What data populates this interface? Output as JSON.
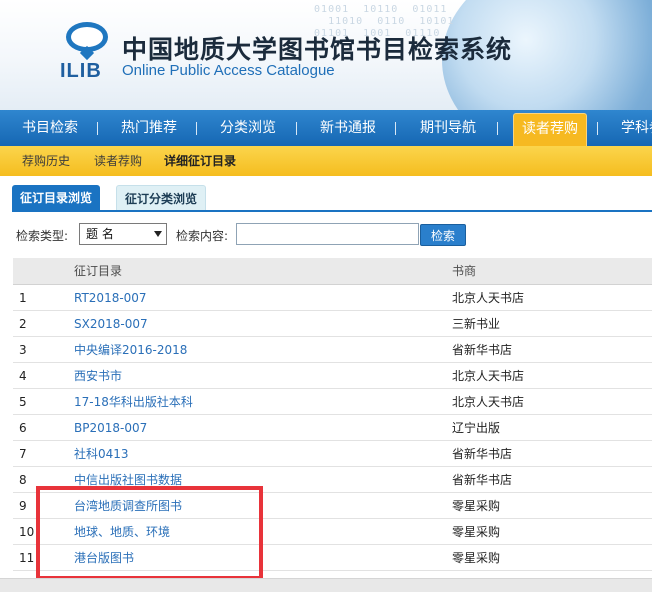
{
  "header": {
    "logo_text": "ILIB",
    "title": "中国地质大学图书馆书目检索系统",
    "subtitle": "Online Public Access Catalogue"
  },
  "nav": {
    "items": [
      "书目检索",
      "热门推荐",
      "分类浏览",
      "新书通报",
      "期刊导航",
      "读者荐购",
      "学科参"
    ],
    "active": "读者荐购"
  },
  "subnav": {
    "items": [
      "荐购历史",
      "读者荐购",
      "详细征订目录"
    ]
  },
  "tabs": {
    "items": [
      "征订目录浏览",
      "征订分类浏览"
    ]
  },
  "search": {
    "type_label": "检索类型:",
    "type_value": "题 名",
    "content_label": "检索内容:",
    "content_value": "",
    "button": "检索"
  },
  "table": {
    "headers": [
      "征订目录",
      "书商"
    ],
    "rows": [
      {
        "no": "1",
        "title": "RT2018-007",
        "vendor": "北京人天书店"
      },
      {
        "no": "2",
        "title": "SX2018-007",
        "vendor": "三新书业"
      },
      {
        "no": "3",
        "title": "中央编译2016-2018",
        "vendor": "省新华书店"
      },
      {
        "no": "4",
        "title": "西安书市",
        "vendor": "北京人天书店"
      },
      {
        "no": "5",
        "title": "17-18华科出版社本科",
        "vendor": "北京人天书店"
      },
      {
        "no": "6",
        "title": "BP2018-007",
        "vendor": "辽宁出版"
      },
      {
        "no": "7",
        "title": "社科0413",
        "vendor": "省新华书店"
      },
      {
        "no": "8",
        "title": "中信出版社图书数据",
        "vendor": "省新华书店"
      },
      {
        "no": "9",
        "title": "台湾地质调查所图书",
        "vendor": "零星采购"
      },
      {
        "no": "10",
        "title": "地球、地质、环境",
        "vendor": "零星采购"
      },
      {
        "no": "11",
        "title": "港台版图书",
        "vendor": "零星采购"
      }
    ]
  },
  "colors": {
    "nav_blue": "#1a73c2",
    "active_tab_yellow": "#f6b921",
    "link_blue": "#2a6fb8",
    "highlight_red": "#e8333a"
  }
}
